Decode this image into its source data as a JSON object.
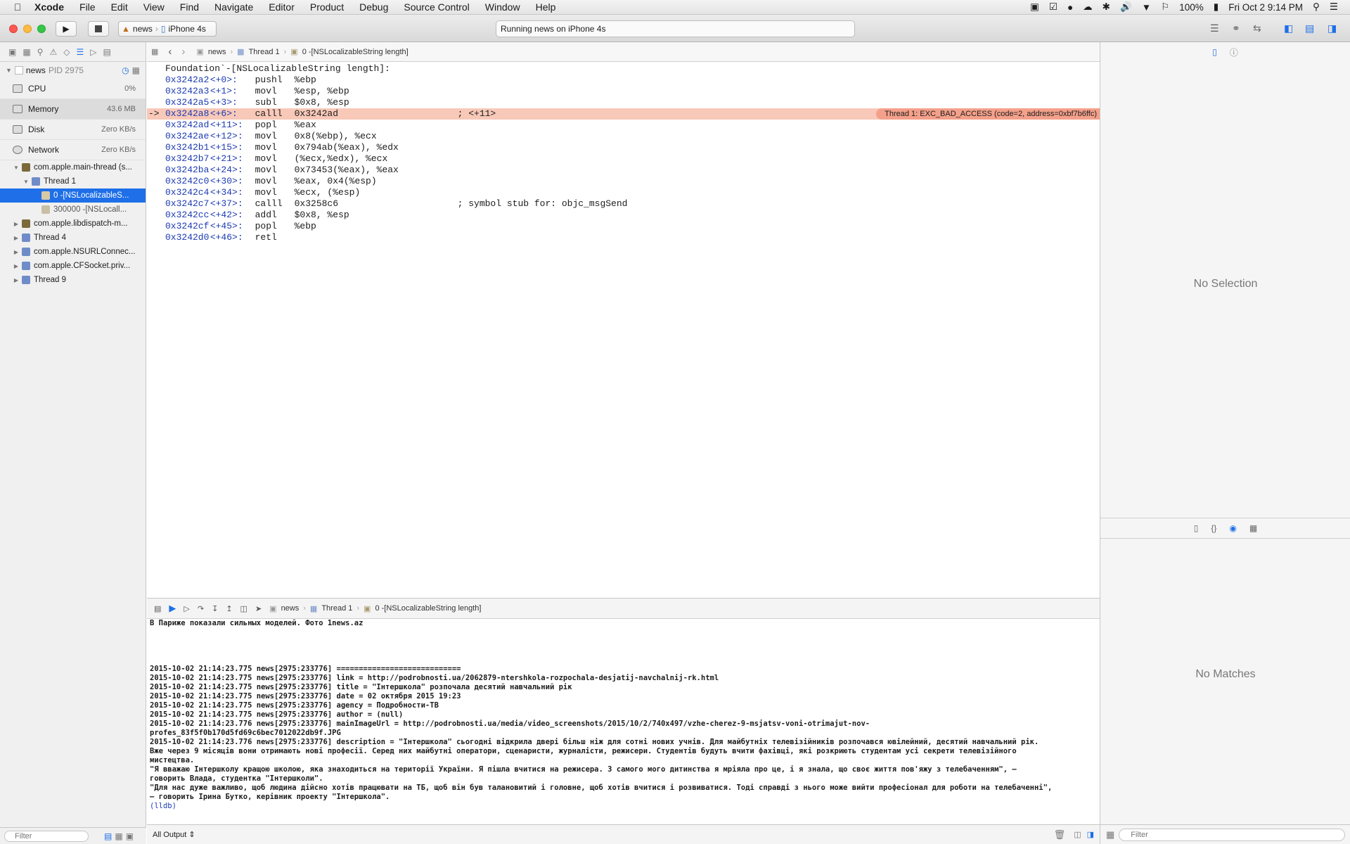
{
  "menubar": {
    "app": "Xcode",
    "items": [
      "File",
      "Edit",
      "View",
      "Find",
      "Navigate",
      "Editor",
      "Product",
      "Debug",
      "Source Control",
      "Window",
      "Help"
    ],
    "battery": "100%",
    "clock": "Fri Oct 2  9:14 PM"
  },
  "toolbar": {
    "scheme_project": "news",
    "scheme_device": "iPhone 4s",
    "activity": "Running news on iPhone 4s"
  },
  "navigator": {
    "process_name": "news",
    "process_pid": "PID 2975",
    "gauges": [
      {
        "label": "CPU",
        "value": "0%"
      },
      {
        "label": "Memory",
        "value": "43.6 MB"
      },
      {
        "label": "Disk",
        "value": "Zero KB/s"
      },
      {
        "label": "Network",
        "value": "Zero KB/s"
      }
    ],
    "threads": [
      {
        "label": "com.apple.main-thread (s...",
        "indent": 0,
        "open": true
      },
      {
        "label": "Thread 1",
        "indent": 1,
        "open": true
      },
      {
        "label": "0 -[NSLocalizableS...",
        "indent": 2,
        "selected": true
      },
      {
        "label": "300000 -[NSLocall...",
        "indent": 2
      },
      {
        "label": "com.apple.libdispatch-m...",
        "indent": 0
      },
      {
        "label": "Thread 4",
        "indent": 0
      },
      {
        "label": "com.apple.NSURLConnec...",
        "indent": 0
      },
      {
        "label": "com.apple.CFSocket.priv...",
        "indent": 0
      },
      {
        "label": "Thread 9",
        "indent": 0
      }
    ],
    "filter_placeholder": "Filter"
  },
  "jumpbar": {
    "project": "news",
    "thread": "Thread 1",
    "frame": "0 -[NSLocalizableString length]"
  },
  "disassembly": {
    "header": "Foundation`-[NSLocalizableString length]:",
    "lines": [
      {
        "addr": "0x3242a2",
        "off": "<+0>:",
        "op": "pushl",
        "args": "%ebp",
        "comment": ""
      },
      {
        "addr": "0x3242a3",
        "off": "<+1>:",
        "op": "movl",
        "args": "%esp, %ebp",
        "comment": ""
      },
      {
        "addr": "0x3242a5",
        "off": "<+3>:",
        "op": "subl",
        "args": "$0x8, %esp",
        "comment": ""
      },
      {
        "addr": "0x3242a8",
        "off": "<+6>:",
        "op": "calll",
        "args": "0x3242ad",
        "comment": "; <+11>",
        "current": true
      },
      {
        "addr": "0x3242ad",
        "off": "<+11>:",
        "op": "popl",
        "args": "%eax",
        "comment": ""
      },
      {
        "addr": "0x3242ae",
        "off": "<+12>:",
        "op": "movl",
        "args": "0x8(%ebp), %ecx",
        "comment": ""
      },
      {
        "addr": "0x3242b1",
        "off": "<+15>:",
        "op": "movl",
        "args": "0x794ab(%eax), %edx",
        "comment": ""
      },
      {
        "addr": "0x3242b7",
        "off": "<+21>:",
        "op": "movl",
        "args": "(%ecx,%edx), %ecx",
        "comment": ""
      },
      {
        "addr": "0x3242ba",
        "off": "<+24>:",
        "op": "movl",
        "args": "0x73453(%eax), %eax",
        "comment": ""
      },
      {
        "addr": "0x3242c0",
        "off": "<+30>:",
        "op": "movl",
        "args": "%eax, 0x4(%esp)",
        "comment": ""
      },
      {
        "addr": "0x3242c4",
        "off": "<+34>:",
        "op": "movl",
        "args": "%ecx, (%esp)",
        "comment": ""
      },
      {
        "addr": "0x3242c7",
        "off": "<+37>:",
        "op": "calll",
        "args": "0x3258c6",
        "comment": "; symbol stub for: objc_msgSend"
      },
      {
        "addr": "0x3242cc",
        "off": "<+42>:",
        "op": "addl",
        "args": "$0x8, %esp",
        "comment": ""
      },
      {
        "addr": "0x3242cf",
        "off": "<+45>:",
        "op": "popl",
        "args": "%ebp",
        "comment": ""
      },
      {
        "addr": "0x3242d0",
        "off": "<+46>:",
        "op": "retl",
        "args": "",
        "comment": ""
      }
    ],
    "pc_arrow": "->",
    "annotation": "Thread 1: EXC_BAD_ACCESS (code=2, address=0xbf7b6ffc)"
  },
  "console": {
    "lines": [
      "В Париже показали сильных моделей. Фото 1news.az",
      "",
      "",
      "",
      "",
      "2015-10-02 21:14:23.775 news[2975:233776] ============================",
      "2015-10-02 21:14:23.775 news[2975:233776] link = http://podrobnosti.ua/2062879-ntershkola-rozpochala-desjatij-navchalnij-rk.html",
      "2015-10-02 21:14:23.775 news[2975:233776] title = \"Інтершкола\" розпочала десятий навчальний рік",
      "2015-10-02 21:14:23.775 news[2975:233776] date = 02 октября 2015 19:23",
      "2015-10-02 21:14:23.775 news[2975:233776] agency = Подробности-ТВ",
      "2015-10-02 21:14:23.775 news[2975:233776] author = (null)",
      "2015-10-02 21:14:23.776 news[2975:233776] mainImageUrl = http://podrobnosti.ua/media/video_screenshots/2015/10/2/740x497/vzhe-cherez-9-msjatsv-voni-otrimajut-nov-",
      "profes_83f5f0b170d5fd69c6bec7012022db9f.JPG",
      "2015-10-02 21:14:23.776 news[2975:233776] description = \"Інтершкола\" сьогодні відкрила двері більш ніж для сотні нових учнів. Для майбутніх телевізійників розпочався ювілейний, десятий навчальний рік.",
      "Вже через 9 місяців вони отримають нові професії. Серед них майбутні оператори, сценаристи, журналісти, режисери. Студентів будуть вчити фахівці, які розкриють студентам усі секрети телевізійного",
      "мистецтва.",
      "\"Я вважаю Інтершколу кращою школою, яка знаходиться на території України. Я пішла вчитися на режисера. З самого мого дитинства я мріяла про це, і я знала, що своє життя пов'яжу з телебаченням\", –",
      "говорить Влада, студентка \"Інтершколи\".",
      "\"Для нас дуже важливо, щоб людина дійсно хотів працювати на ТБ, щоб він був талановитий і головне, щоб хотів вчитися і розвиватися. Тоді справді з нього може вийти професіонал для роботи на телебаченні\",",
      "– говорить Ірина Бутко, керівник проекту \"Інтершкола\"."
    ],
    "prompt": "(lldb)",
    "output_select": "All Output"
  },
  "inspector": {
    "no_selection": "No Selection",
    "no_matches": "No Matches",
    "filter_placeholder": "Filter"
  },
  "colors": {
    "accent": "#1e6fe8",
    "highlight": "#f8c8b8",
    "annotation": "#f4a08a",
    "address": "#1b3ab1"
  }
}
